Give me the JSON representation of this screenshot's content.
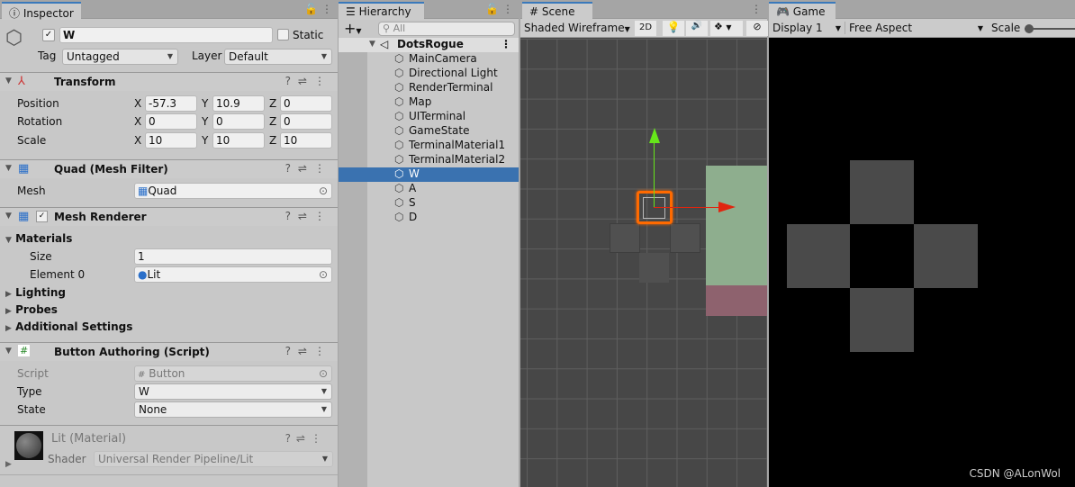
{
  "inspector": {
    "tab": "Inspector",
    "name": "W",
    "static_label": "Static",
    "tag_label": "Tag",
    "tag": "Untagged",
    "layer_label": "Layer",
    "layer": "Default",
    "transform": {
      "title": "Transform",
      "rows": [
        {
          "label": "Position",
          "x": "-57.3",
          "y": "10.9",
          "z": "0"
        },
        {
          "label": "Rotation",
          "x": "0",
          "y": "0",
          "z": "0"
        },
        {
          "label": "Scale",
          "x": "10",
          "y": "10",
          "z": "10"
        }
      ]
    },
    "mesh_filter": {
      "title": "Quad (Mesh Filter)",
      "mesh_label": "Mesh",
      "mesh": "Quad"
    },
    "mesh_renderer": {
      "title": "Mesh Renderer",
      "materials": "Materials",
      "size_label": "Size",
      "size": "1",
      "element_label": "Element 0",
      "element": "Lit",
      "lighting": "Lighting",
      "probes": "Probes",
      "additional": "Additional Settings"
    },
    "button_authoring": {
      "title": "Button Authoring (Script)",
      "script_label": "Script",
      "script": "Button",
      "type_label": "Type",
      "type": "W",
      "state_label": "State",
      "state": "None"
    },
    "material": {
      "title": "Lit (Material)",
      "shader_label": "Shader",
      "shader": "Universal Render Pipeline/Lit"
    }
  },
  "hierarchy": {
    "tab": "Hierarchy",
    "search_placeholder": "All",
    "scene": "DotsRogue",
    "items": [
      "MainCamera",
      "Directional Light",
      "RenderTerminal",
      "Map",
      "UITerminal",
      "GameState",
      "TerminalMaterial1",
      "TerminalMaterial2",
      "W",
      "A",
      "S",
      "D"
    ],
    "selected": "W"
  },
  "scene": {
    "tab": "Scene",
    "draw_mode": "Shaded Wireframe",
    "mode_2d": "2D"
  },
  "game": {
    "tab": "Game",
    "display": "Display 1",
    "aspect": "Free Aspect",
    "scale_label": "Scale",
    "watermark": "CSDN @ALonWol"
  },
  "colors": {
    "selection": "#3a72b0",
    "gizmo_x": "#e0250f",
    "gizmo_y": "#66e61a",
    "highlight": "#ff6a00"
  }
}
